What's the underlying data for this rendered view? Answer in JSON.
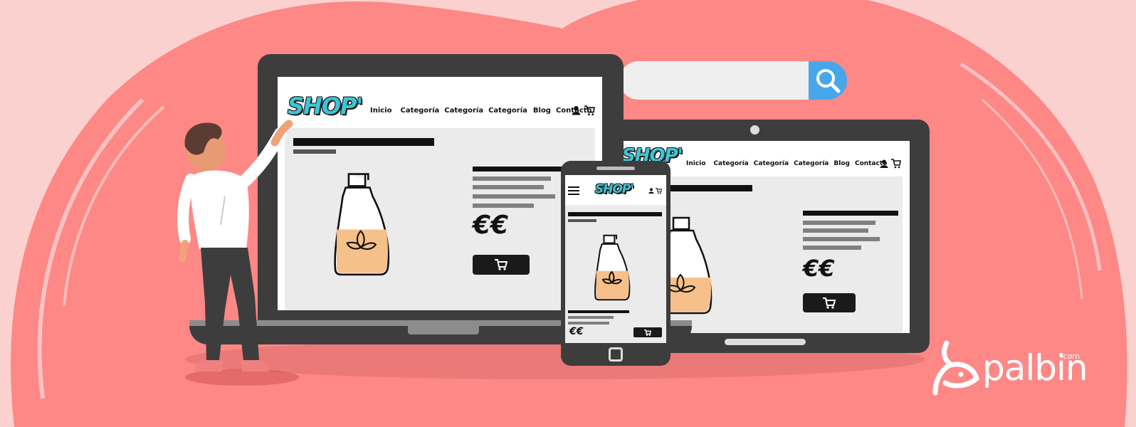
{
  "search": {
    "placeholder": ""
  },
  "shop": {
    "logo": "SHOP'",
    "nav": [
      "Inicio",
      "Categoría",
      "Categoría",
      "Categoría",
      "Blog",
      "Contacto"
    ],
    "price": "€€"
  },
  "brand": {
    "name": "palbin",
    "tld": ".com"
  },
  "colors": {
    "background": "#fd8886",
    "accent": "#3cc6d6",
    "search_button": "#48a7ea",
    "product_fill": "#f6c08a"
  }
}
